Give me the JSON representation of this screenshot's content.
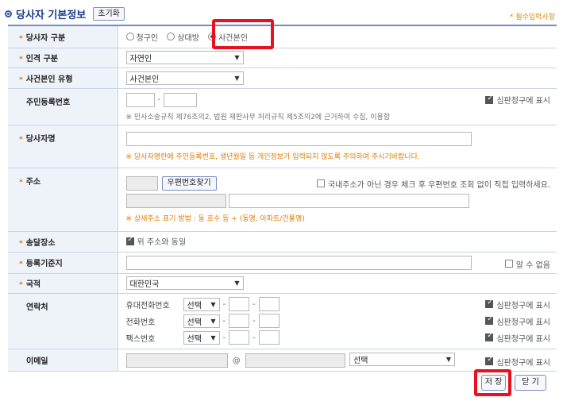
{
  "header": {
    "title": "당사자 기본정보",
    "reset_label": "초기화",
    "required_note": "* 필수입력사항"
  },
  "rows": {
    "party_type": {
      "label": "당사자 구분",
      "options": [
        "청구인",
        "상대방",
        "사건본인"
      ],
      "selected": "사건본인"
    },
    "person_type": {
      "label": "인격 구분",
      "value": "자연인"
    },
    "principal_type": {
      "label": "사건본인 유형",
      "value": "사건본인"
    },
    "rrn": {
      "label": "주민등록번호",
      "dash": "-",
      "show_check": "심판청구에 표시",
      "note": "※ 민사소송규칙 제76조의2, 법원 재판사무 처리규칙 제5조의2에 근거하여 수집, 이용함"
    },
    "name": {
      "label": "당사자명",
      "note": "※ 당사자명란에 주민등록번호, 생년월일 등 개인정보가 입력되지 않도록 주의하여 주시기바랍니다."
    },
    "address": {
      "label": "주소",
      "postcode_button": "우편번호찾기",
      "domestic_check": "국내주소가 아닌 경우 체크 후 우편번호 조회 없이 직접 입력하세요.",
      "note": "※ 상세주소 표기 방법 : 동 호수 등 + (동명, 아파트/건물명)"
    },
    "delivery": {
      "label": "송달장소",
      "same_check": "위 주소와 동일"
    },
    "registry": {
      "label": "등록기준지",
      "unknown_check": "알 수 없음"
    },
    "nationality": {
      "label": "국적",
      "value": "대한민국"
    },
    "contact": {
      "label": "연락처",
      "items": [
        {
          "label": "휴대전화번호",
          "select": "선택",
          "show": "심판청구에 표시"
        },
        {
          "label": "전화번호",
          "select": "선택",
          "show": "심판청구에 표시"
        },
        {
          "label": "팩스번호",
          "select": "선택",
          "show": "심판청구에 표시"
        }
      ],
      "dash": "-"
    },
    "email": {
      "label": "이메일",
      "at": "@",
      "domain_select": "선택",
      "show": "심판청구에 표시"
    }
  },
  "footer": {
    "save_label": "저 장",
    "close_label": "닫 기"
  },
  "colors": {
    "highlight": "#e8111f",
    "accent": "#1b3a8a",
    "required": "#e07b00"
  }
}
